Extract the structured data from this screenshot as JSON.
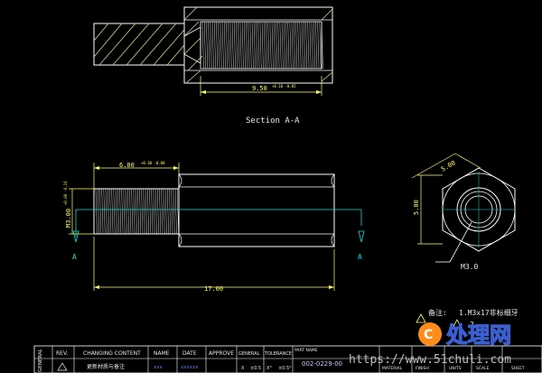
{
  "drawing": {
    "section_title": "Section A-A",
    "dims": {
      "top_length": "9.50",
      "top_tol": "+0.10 -0.05",
      "side_thread_len": "6.00",
      "side_thread_tol": "+0.30 -0.00",
      "thread_dia": "M3.00",
      "thread_dia_tol": "+0.00 -0.10",
      "overall_length": "17.00",
      "hex_flat": "5.00",
      "hex_height": "5.00",
      "end_thread": "M3.0",
      "section_marker": "A"
    },
    "note": {
      "label": "备注:",
      "line1": "1.M3x17非标细牙",
      "line2": "2."
    }
  },
  "title_block": {
    "side_label": "GENERAL",
    "headers": [
      "REV.",
      "CHANGING CONTENT",
      "NAME",
      "DATE",
      "APPROVE",
      "GENERAL",
      "TOLERANCE",
      "PART NAME",
      "",
      "MATERIAL",
      "FINISH",
      "UNITS",
      "SCALE",
      "SHEET"
    ],
    "row": {
      "content": "更新材质与备注",
      "name_val": "xxx",
      "date_val": "xxxxxx",
      "tol_x": "X",
      "tol_val1": "±0.5",
      "tol_x2": "X°",
      "tol_val2": "±0.5°",
      "part_no": "002-0229-00"
    }
  },
  "watermark": {
    "url": "https://www.51chuli.com",
    "brand": "处理网"
  },
  "colors": {
    "outline": "#ffffff",
    "dimension": "#ffff66",
    "centerline": "#00e0e0",
    "hatch": "#e8e8a0",
    "title_value": "#5a7cff"
  }
}
